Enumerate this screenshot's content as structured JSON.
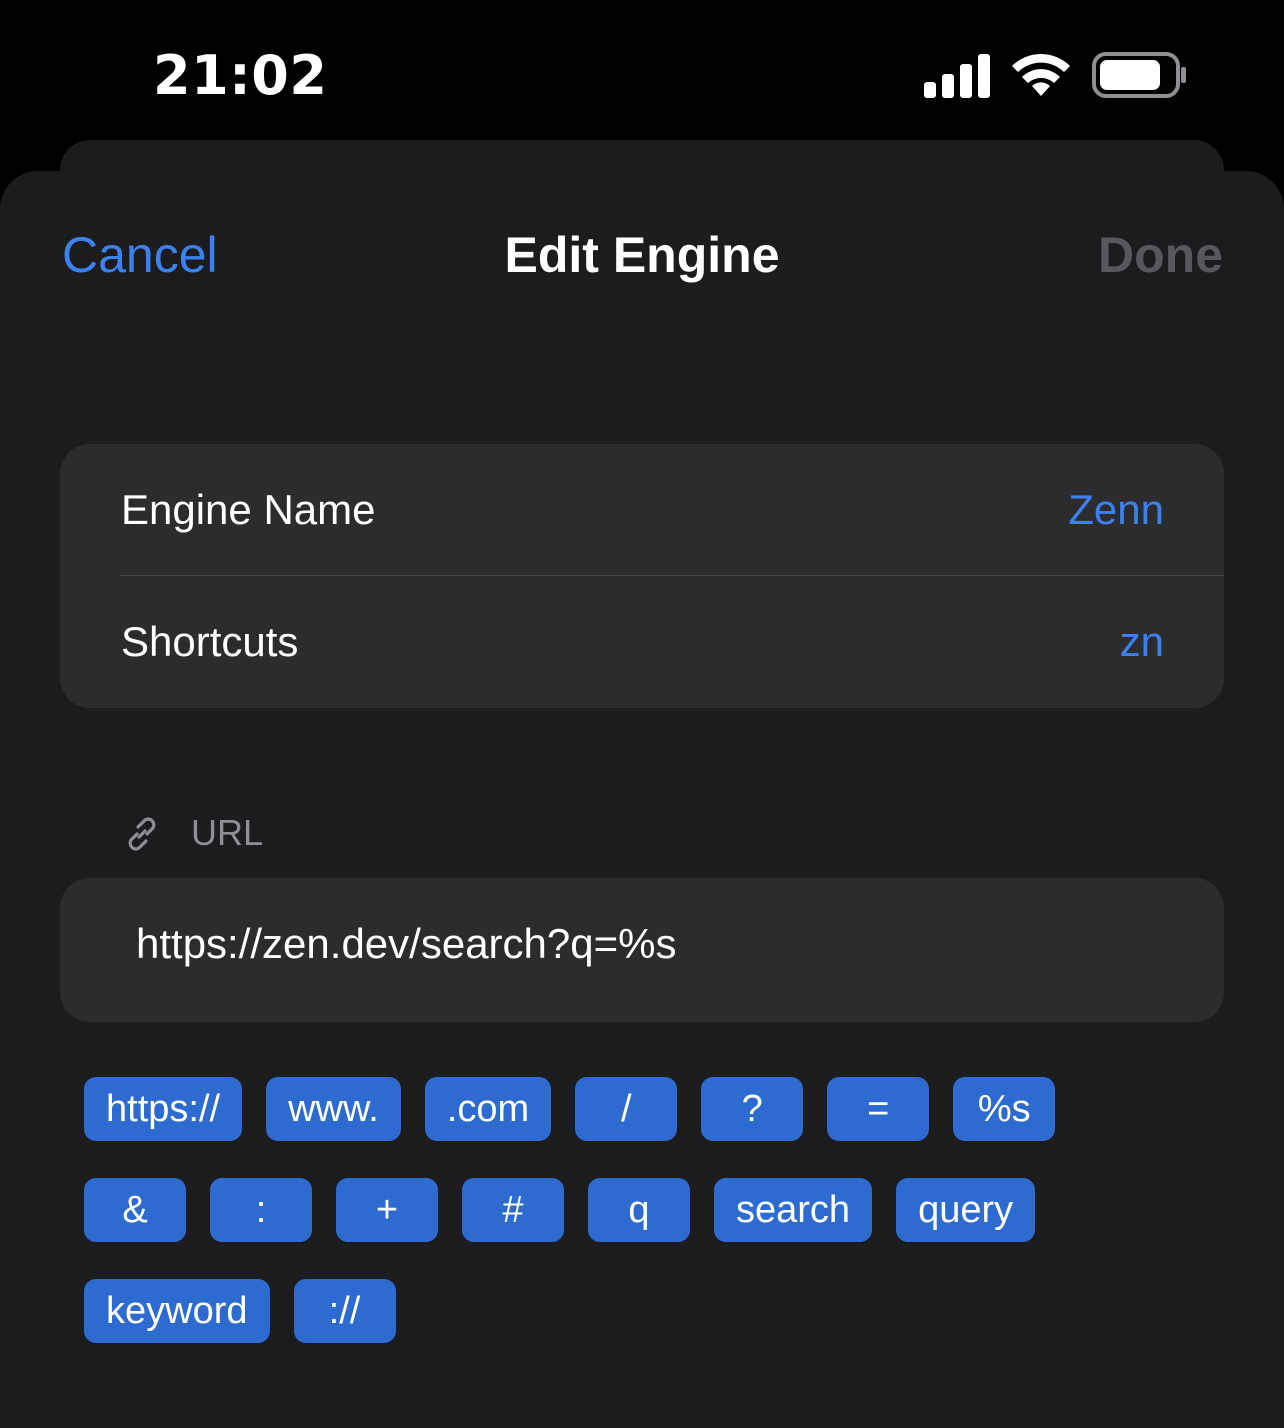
{
  "status_bar": {
    "time": "21:02",
    "signal_icon": "cellular-signal-icon",
    "wifi_icon": "wifi-icon",
    "battery_icon": "battery-icon"
  },
  "nav": {
    "cancel_label": "Cancel",
    "title": "Edit Engine",
    "done_label": "Done"
  },
  "fields": [
    {
      "label": "Engine Name",
      "value": "Zenn"
    },
    {
      "label": "Shortcuts",
      "value": "zn"
    }
  ],
  "url_section": {
    "icon": "link-icon",
    "label": "URL",
    "value": "https://zen.dev/search?q=%s"
  },
  "chips": {
    "row1": [
      "https://",
      "www.",
      ".com",
      "/",
      "?",
      "=",
      "%s"
    ],
    "row2": [
      "&",
      ":",
      "+",
      "#",
      "q",
      "search",
      "query"
    ],
    "row3": [
      "keyword",
      "://"
    ]
  },
  "colors": {
    "accent": "#3b82f0",
    "chip": "#2d6bd0",
    "sheet": "#1c1c1e",
    "group": "#2c2c2e",
    "disabled": "#58585c"
  }
}
